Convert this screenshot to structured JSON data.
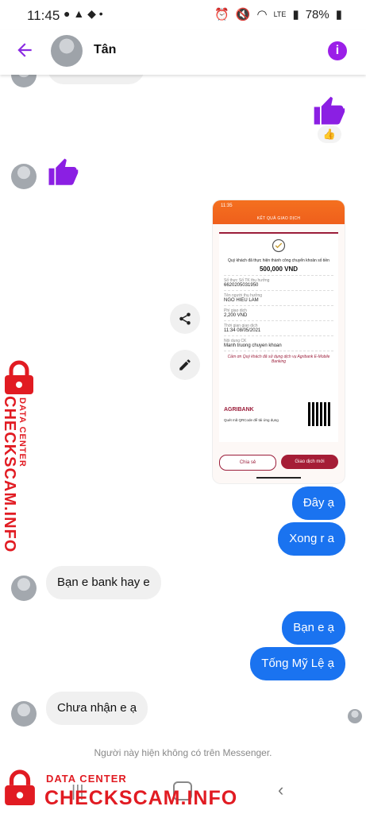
{
  "status": {
    "time": "11:45",
    "lte": "LTE",
    "battery": "78%"
  },
  "header": {
    "name": "Tân"
  },
  "messages": {
    "receipt": {
      "time": "11:35",
      "title": "KẾT QUẢ GIAO DỊCH",
      "success_line": "Quý khách đã thực hiện thành công chuyển khoản số tiền",
      "amount": "500,000 VND",
      "account_label": "Số thực Số TK thụ hưởng",
      "account": "6620205031950",
      "name_label": "Tên người thụ hưởng",
      "beneficiary": "NGO HIEU LAM",
      "fee_label": "Phí giao dịch",
      "fee": "2,200 VND",
      "time_label": "Thời gian giao dịch",
      "datetime": "11:34 08/05/2021",
      "content_label": "Nội dung CK",
      "content": "Manh truong chuyen khoan",
      "thanks": "Cảm ơn Quý khách đã sử dụng dịch vụ Agribank E-Mobile Banking",
      "bank": "AGRIBANK",
      "qr_note": "Quét mã QRCode để tải ứng dụng",
      "share_btn": "Chia sẻ",
      "new_btn": "Giao dịch mới"
    },
    "out1": "Đây ạ",
    "out2": "Xong r a",
    "in1": "Bạn e bank hay e",
    "out3": "Bạn e ạ",
    "out4": "Tống Mỹ Lệ ạ",
    "in2": "Chưa nhận e ạ"
  },
  "footer_note": "Người này hiện không có trên Messenger.",
  "watermark": {
    "side_small": "DATA CENTER",
    "side_big": "CHECKSCAM.INFO",
    "bottom_small": "DATA CENTER",
    "bottom_big": "CHECKSCAM.INFO"
  },
  "colors": {
    "accent": "#8a2be2",
    "outgoing": "#1a73f0",
    "watermark": "#e11b22"
  },
  "icons": {
    "back": "arrow-left-icon",
    "info": "info-icon",
    "like": "thumbs-up-icon",
    "share": "share-icon",
    "edit": "pencil-icon"
  }
}
